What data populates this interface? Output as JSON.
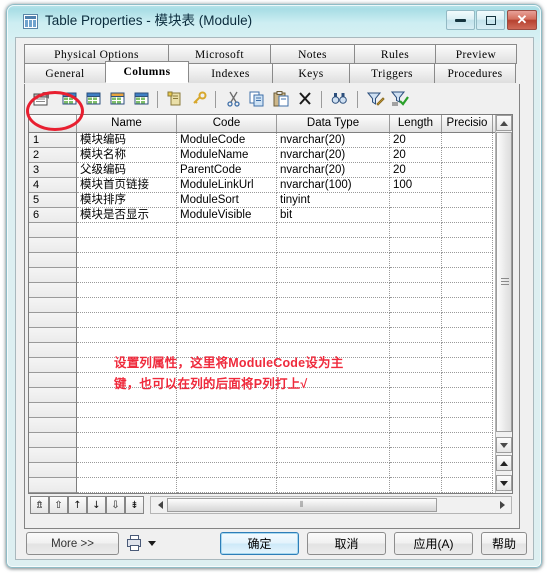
{
  "window": {
    "title": "Table Properties - 模块表 (Module)",
    "icon": "table-icon",
    "min_label": "",
    "max_label": "",
    "close_label": "✕"
  },
  "tabs": {
    "row1": [
      {
        "label": "Physical Options",
        "name": "tab-physical-options",
        "active": false
      },
      {
        "label": "Microsoft",
        "name": "tab-microsoft",
        "active": false
      },
      {
        "label": "Notes",
        "name": "tab-notes",
        "active": false
      },
      {
        "label": "Rules",
        "name": "tab-rules",
        "active": false
      },
      {
        "label": "Preview",
        "name": "tab-preview",
        "active": false
      }
    ],
    "row2": [
      {
        "label": "General",
        "name": "tab-general",
        "active": false
      },
      {
        "label": "Columns",
        "name": "tab-columns",
        "active": true
      },
      {
        "label": "Indexes",
        "name": "tab-indexes",
        "active": false
      },
      {
        "label": "Keys",
        "name": "tab-keys",
        "active": false
      },
      {
        "label": "Triggers",
        "name": "tab-triggers",
        "active": false
      },
      {
        "label": "Procedures",
        "name": "tab-procedures",
        "active": false
      }
    ]
  },
  "toolbar": {
    "items": [
      {
        "name": "properties-icon",
        "title": "Properties",
        "highlighted": true
      },
      {
        "name": "insert-row-icon",
        "title": "Insert a Row"
      },
      {
        "name": "add-row-icon",
        "title": "Add a Row"
      },
      {
        "name": "add-column-icon",
        "title": "Add Column"
      },
      {
        "name": "replicate-column-icon",
        "title": "Replicate Column"
      },
      {
        "name": "add-note-icon",
        "title": "Add"
      },
      {
        "name": "key-icon",
        "title": "Key"
      },
      {
        "name": "cut-icon",
        "title": "Cut"
      },
      {
        "name": "copy-icon",
        "title": "Copy"
      },
      {
        "name": "paste-icon",
        "title": "Paste"
      },
      {
        "name": "delete-icon",
        "title": "Delete"
      },
      {
        "name": "find-icon",
        "title": "Find"
      },
      {
        "name": "filter-edit-icon",
        "title": "Customize Columns and Filter"
      },
      {
        "name": "filter-apply-icon",
        "title": "Apply Filter"
      }
    ]
  },
  "grid": {
    "headers": [
      "",
      "Name",
      "Code",
      "Data Type",
      "Length",
      "Precisio"
    ],
    "rows": [
      {
        "n": "1",
        "name": "模块编码",
        "code": "ModuleCode",
        "type": "nvarchar(20)",
        "length": "20",
        "precision": ""
      },
      {
        "n": "2",
        "name": "模块名称",
        "code": "ModuleName",
        "type": "nvarchar(20)",
        "length": "20",
        "precision": ""
      },
      {
        "n": "3",
        "name": "父级编码",
        "code": "ParentCode",
        "type": "nvarchar(20)",
        "length": "20",
        "precision": ""
      },
      {
        "n": "4",
        "name": "模块首页链接",
        "code": "ModuleLinkUrl",
        "type": "nvarchar(100)",
        "length": "100",
        "precision": ""
      },
      {
        "n": "5",
        "name": "模块排序",
        "code": "ModuleSort",
        "type": "tinyint",
        "length": "",
        "precision": ""
      },
      {
        "n": "6",
        "name": "模块是否显示",
        "code": "ModuleVisible",
        "type": "bit",
        "length": "",
        "precision": ""
      }
    ],
    "empty_row_count": 22
  },
  "annotation": {
    "text": "设置列属性，这里将ModuleCode设为主\n键，也可以在列的后面将P列打上√",
    "color": "#ef2a3c"
  },
  "row_nav": {
    "buttons": [
      {
        "name": "nav-first-row-button",
        "glyph": "⇯"
      },
      {
        "name": "nav-prev-page-button",
        "glyph": "⇧"
      },
      {
        "name": "nav-prev-row-button",
        "glyph": "↑"
      },
      {
        "name": "nav-next-row-button",
        "glyph": "↓"
      },
      {
        "name": "nav-next-page-button",
        "glyph": "⇩"
      },
      {
        "name": "nav-last-row-button",
        "glyph": "⇟"
      }
    ]
  },
  "scrollbars": {
    "vertical_thumb_grip": "≡",
    "horizontal_thumb_grip": "⦀"
  },
  "footer": {
    "more_label": "More >>",
    "ok_label": "确定",
    "cancel_label": "取消",
    "apply_label": "应用(A)",
    "help_label": "帮助",
    "print_icon": "print-icon"
  },
  "colors": {
    "accent": "#2e7eb8",
    "annotation_red": "#ef2a3c",
    "title_glass": "#cdeef2",
    "close_red": "#b6412f"
  }
}
